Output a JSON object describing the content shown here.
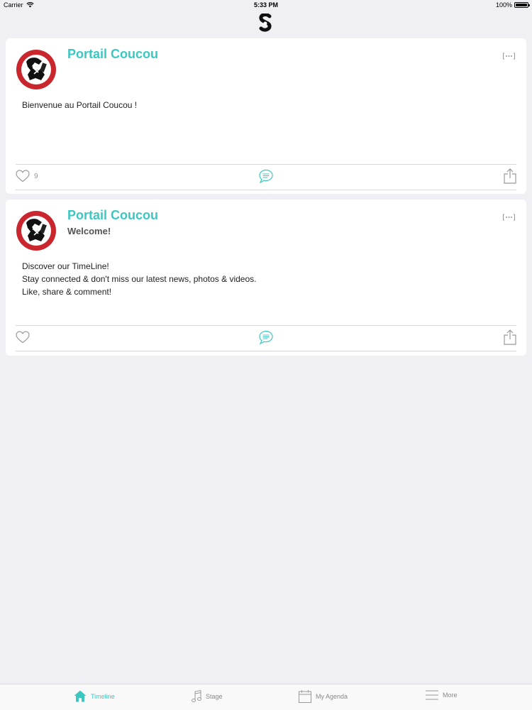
{
  "status_bar": {
    "carrier": "Carrier",
    "time": "5:33 PM",
    "battery": "100%"
  },
  "posts": [
    {
      "author": "Portail Coucou",
      "subtitle": "",
      "body": [
        "Bienvenue au Portail Coucou !"
      ],
      "like_count": "9"
    },
    {
      "author": "Portail Coucou",
      "subtitle": "Welcome!",
      "body": [
        "Discover our TimeLine!",
        "Stay connected & don't miss our latest news, photos & videos.",
        "Like, share & comment!"
      ],
      "like_count": ""
    }
  ],
  "tabs": [
    {
      "label": "Timeline",
      "icon": "home-icon",
      "active": true
    },
    {
      "label": "Stage",
      "icon": "music-note-icon",
      "active": false
    },
    {
      "label": "My Agenda",
      "icon": "calendar-icon",
      "active": false
    },
    {
      "label": "More",
      "icon": "menu-icon",
      "active": false
    }
  ],
  "colors": {
    "accent": "#3cc7c0",
    "background": "#efeff4",
    "like_red": "#c92a2a"
  }
}
